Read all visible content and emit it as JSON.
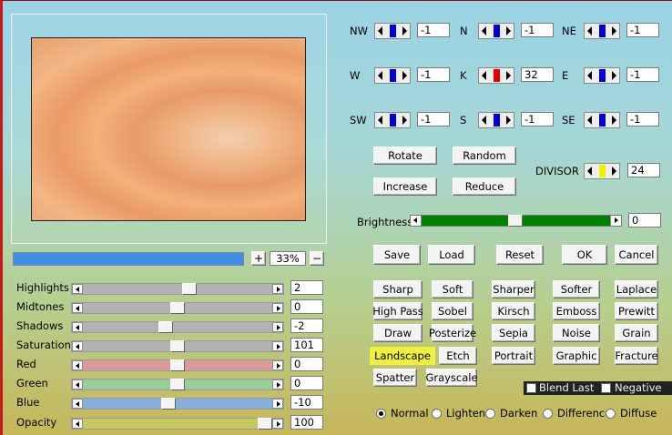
{
  "preview": {
    "zoom": "33%",
    "plus": "+",
    "minus": "−"
  },
  "kernel": {
    "cells": [
      {
        "id": "nw",
        "label": "NW",
        "value": "-1",
        "color": "#0000d0"
      },
      {
        "id": "n",
        "label": "N",
        "value": "-1",
        "color": "#0000d0"
      },
      {
        "id": "ne",
        "label": "NE",
        "value": "-1",
        "color": "#0000d0"
      },
      {
        "id": "w",
        "label": "W",
        "value": "-1",
        "color": "#0000d0"
      },
      {
        "id": "k",
        "label": "K",
        "value": "32",
        "color": "#e00000"
      },
      {
        "id": "e",
        "label": "E",
        "value": "-1",
        "color": "#0000d0"
      },
      {
        "id": "sw",
        "label": "SW",
        "value": "-1",
        "color": "#0000d0"
      },
      {
        "id": "s",
        "label": "S",
        "value": "-1",
        "color": "#0000d0"
      },
      {
        "id": "se",
        "label": "SE",
        "value": "-1",
        "color": "#0000d0"
      }
    ],
    "divisor_label": "DIVISOR",
    "divisor_value": "24",
    "divisor_color": "#f0f000"
  },
  "actions": {
    "rotate": "Rotate",
    "random": "Random",
    "increase": "Increase",
    "reduce": "Reduce"
  },
  "brightness": {
    "label": "Brightness",
    "value": "0",
    "color": "#008000"
  },
  "dialog": {
    "save": "Save",
    "load": "Load",
    "reset": "Reset",
    "ok": "OK",
    "cancel": "Cancel"
  },
  "adjustments": [
    {
      "label": "Highlights",
      "value": "2",
      "level": 0.57,
      "track": "#b2b2b2"
    },
    {
      "label": "Midtones",
      "value": "0",
      "level": 0.5,
      "track": "#b2b2b2"
    },
    {
      "label": "Shadows",
      "value": "-2",
      "level": 0.43,
      "track": "#b2b2b2"
    },
    {
      "label": "Saturation",
      "value": "101",
      "level": 0.5,
      "track": "#b2b2b2"
    },
    {
      "label": "Red",
      "value": "0",
      "level": 0.5,
      "track": "#d99a9a"
    },
    {
      "label": "Green",
      "value": "0",
      "level": 0.5,
      "track": "#99cc99"
    },
    {
      "label": "Blue",
      "value": "-10",
      "level": 0.45,
      "track": "#88aedb"
    },
    {
      "label": "Opacity",
      "value": "100",
      "level": 1.0,
      "track": "#c8c860"
    }
  ],
  "presets": [
    "Sharp",
    "Soft",
    "Sharper",
    "Softer",
    "Laplace",
    "High Pass",
    "Sobel",
    "Kirsch",
    "Emboss",
    "Prewitt",
    "Draw",
    "Posterize",
    "Sepia",
    "Noise",
    "Grain",
    "Landscape",
    "Etch",
    "Portrait",
    "Graphic",
    "Fracture",
    "Spatter",
    "Grayscale"
  ],
  "highlighted_preset": "Landscape",
  "options": {
    "blend_last": "Blend Last",
    "negative": "Negative"
  },
  "blend_modes": [
    "Normal",
    "Lighten",
    "Darken",
    "Difference",
    "Diffuse"
  ],
  "selected_blend": "Normal"
}
